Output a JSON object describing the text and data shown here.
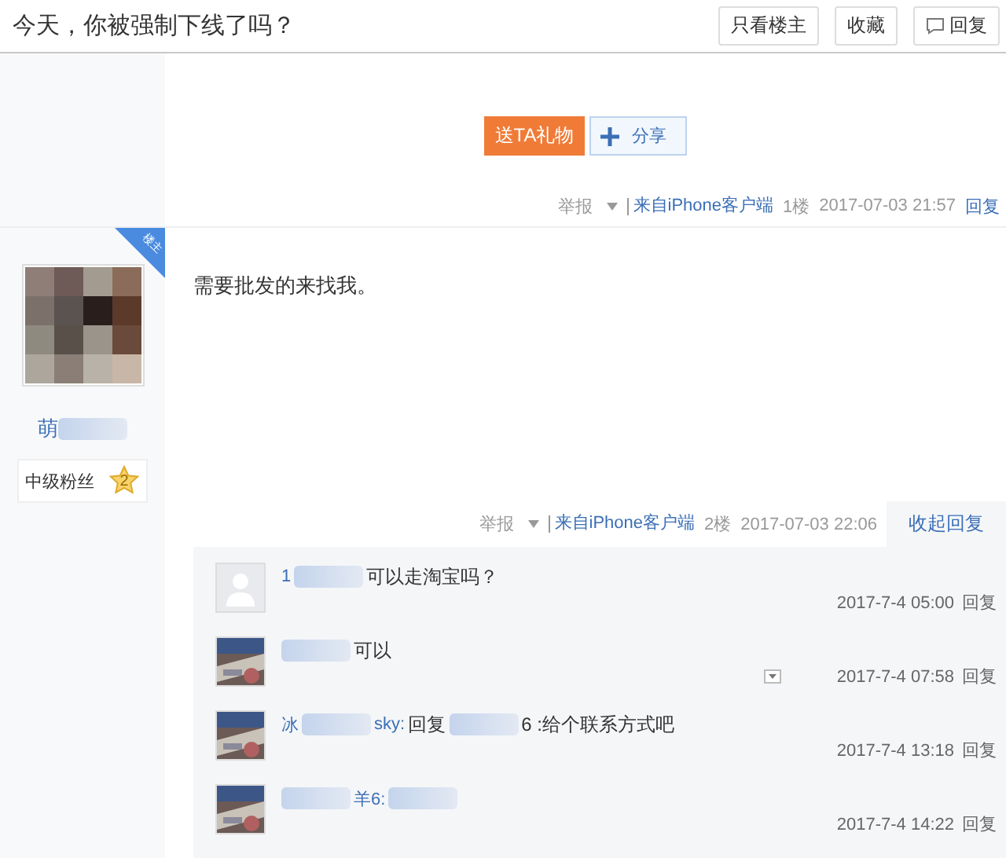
{
  "header": {
    "title": "今天，你被强制下线了吗？",
    "buttons": [
      {
        "label": "只看楼主",
        "kind": "plain"
      },
      {
        "label": "收藏",
        "kind": "plain"
      },
      {
        "label": "回复",
        "kind": "reply"
      }
    ]
  },
  "posts": [
    {
      "actions": [
        {
          "label": "送TA礼物",
          "kind": "gift"
        },
        {
          "label": "分享",
          "kind": "share"
        }
      ],
      "meta": {
        "report": "举报",
        "source": "来自iPhone客户端",
        "floor": "1楼",
        "time": "2017-07-03 21:57",
        "reply": "回复"
      }
    },
    {
      "author": {
        "owner_tag": "楼主",
        "name": "萌",
        "rank": "中级粉丝",
        "level": "2"
      },
      "content": "需要批发的来找我。",
      "meta": {
        "report": "举报",
        "source": "来自iPhone客户端",
        "floor": "2楼",
        "time": "2017-07-03 22:06",
        "reply": "收起回复"
      },
      "comments": [
        {
          "kind": "placeholder_avatar",
          "parts": [
            {
              "kind": "name",
              "text": "1"
            },
            {
              "kind": "blur"
            },
            {
              "kind": "text",
              "text": "可以走淘宝吗？"
            }
          ],
          "menu": false,
          "time": "2017-7-4 05:00",
          "reply": "回复"
        },
        {
          "kind": "photo_avatar",
          "parts": [
            {
              "kind": "blur"
            },
            {
              "kind": "text",
              "text": "可以"
            }
          ],
          "menu": true,
          "time": "2017-7-4 07:58",
          "reply": "回复"
        },
        {
          "kind": "photo_avatar",
          "parts": [
            {
              "kind": "name",
              "text": "冰"
            },
            {
              "kind": "blur"
            },
            {
              "kind": "name",
              "text": "sky:"
            },
            {
              "kind": "text",
              "text": "回复"
            },
            {
              "kind": "blur"
            },
            {
              "kind": "text",
              "text": "6 :给个联系方式吧"
            }
          ],
          "menu": false,
          "time": "2017-7-4 13:18",
          "reply": "回复"
        },
        {
          "kind": "photo_avatar",
          "parts": [
            {
              "kind": "blur"
            },
            {
              "kind": "name",
              "text": "羊6:"
            },
            {
              "kind": "blur"
            }
          ],
          "menu": false,
          "time": "2017-7-4 14:22",
          "reply": "回复"
        }
      ]
    }
  ]
}
